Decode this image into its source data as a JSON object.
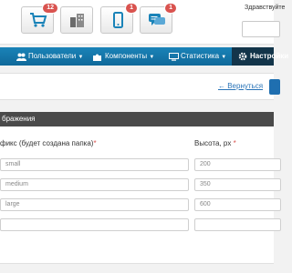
{
  "header": {
    "greeting": "Здравствуйте",
    "quick_buttons": [
      {
        "icon": "shopping-cart-icon",
        "badge": "12"
      },
      {
        "icon": "buildings-icon",
        "badge": ""
      },
      {
        "icon": "mobile-phone-icon",
        "badge": "1"
      },
      {
        "icon": "chat-bubbles-icon",
        "badge": "1"
      }
    ]
  },
  "nav": {
    "items": [
      {
        "label": "Пользователи",
        "icon": "users-icon"
      },
      {
        "label": "Компоненты",
        "icon": "puzzle-icon"
      },
      {
        "label": "Статистика",
        "icon": "monitor-icon"
      },
      {
        "label": "Настройки",
        "icon": "gear-icon",
        "active": true
      }
    ]
  },
  "toolbar": {
    "back_label": "← Вернуться"
  },
  "section": {
    "title": "бражения"
  },
  "table": {
    "col_suffix": "фикс (будет создана папка)",
    "col_height": "Высота, px",
    "required_mark": "*",
    "rows": [
      {
        "suffix": "small",
        "height": "200"
      },
      {
        "suffix": "medium",
        "height": "350"
      },
      {
        "suffix": "large",
        "height": "600"
      },
      {
        "suffix": "",
        "height": ""
      }
    ]
  },
  "colors": {
    "nav_bg": "#1a83b8",
    "nav_active": "#13354a",
    "badge": "#d9534f",
    "section_bg": "#4a4a4a",
    "link": "#2a74b8"
  }
}
